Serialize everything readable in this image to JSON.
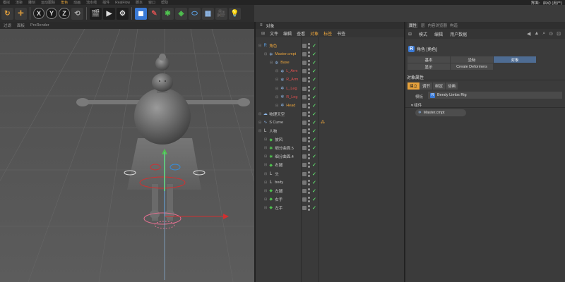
{
  "menubar": {
    "items": [
      "模拟",
      "渲染",
      "雕刻",
      "运动跟踪",
      "角色",
      "动画",
      "流水线",
      "插件",
      "RealFlow",
      "脚本",
      "窗口",
      "帮助"
    ],
    "layout_label": "界面:",
    "layout_value": "启动 (用户)"
  },
  "toolbar": {
    "axes": [
      "X",
      "Y",
      "Z"
    ]
  },
  "viewport": {
    "tabs": [
      "过滤",
      "面板",
      "ProRender"
    ]
  },
  "object_manager": {
    "title": "对象",
    "menu": [
      "文件",
      "编辑",
      "查看",
      "对象",
      "标签",
      "书签"
    ],
    "active_menu": "对象",
    "rows": [
      {
        "name": "角色",
        "indent": 0,
        "icon": "character-icon",
        "color": "#e8a33c",
        "tag": ""
      },
      {
        "name": "Master.cmpt",
        "indent": 1,
        "icon": "joint-icon",
        "color": "#e8a33c",
        "tag": ""
      },
      {
        "name": "Base",
        "indent": 2,
        "icon": "joint-icon",
        "color": "#e8a33c",
        "tag": ""
      },
      {
        "name": "L_Arm",
        "indent": 3,
        "icon": "joint-icon",
        "color": "#e05050",
        "tag": ""
      },
      {
        "name": "R_Arm",
        "indent": 3,
        "icon": "joint-icon",
        "color": "#e05050",
        "tag": ""
      },
      {
        "name": "L_Leg",
        "indent": 3,
        "icon": "joint-icon",
        "color": "#e05050",
        "tag": ""
      },
      {
        "name": "R_Leg",
        "indent": 3,
        "icon": "joint-icon",
        "color": "#e05050",
        "tag": ""
      },
      {
        "name": "Head",
        "indent": 3,
        "icon": "joint-icon",
        "color": "#e8a33c",
        "tag": ""
      },
      {
        "name": "物理天空",
        "indent": 0,
        "icon": "sky-icon",
        "color": "#c8c8c8",
        "tag": ""
      },
      {
        "name": "S Curve",
        "indent": 0,
        "icon": "spline-icon",
        "color": "#c8c8c8",
        "tag": "spline"
      },
      {
        "name": "人物",
        "indent": 0,
        "icon": "null-icon",
        "color": "#c8c8c8",
        "tag": ""
      },
      {
        "name": "披风",
        "indent": 1,
        "icon": "poly-icon",
        "color": "#c8c8c8",
        "tag": ""
      },
      {
        "name": "细分曲面.5",
        "indent": 1,
        "icon": "subdivision-icon",
        "color": "#c8c8c8",
        "tag": ""
      },
      {
        "name": "细分曲面.4",
        "indent": 1,
        "icon": "subdivision-icon",
        "color": "#c8c8c8",
        "tag": ""
      },
      {
        "name": "右腿",
        "indent": 1,
        "icon": "poly-icon",
        "color": "#c8c8c8",
        "tag": ""
      },
      {
        "name": "头",
        "indent": 1,
        "icon": "null-icon",
        "color": "#c8c8c8",
        "tag": ""
      },
      {
        "name": "body",
        "indent": 1,
        "icon": "null-icon",
        "color": "#c8c8c8",
        "tag": ""
      },
      {
        "name": "左腿",
        "indent": 1,
        "icon": "poly-icon",
        "color": "#c8c8c8",
        "tag": ""
      },
      {
        "name": "右手",
        "indent": 1,
        "icon": "poly-icon",
        "color": "#c8c8c8",
        "tag": ""
      },
      {
        "name": "左手",
        "indent": 1,
        "icon": "poly-icon",
        "color": "#c8c8c8",
        "tag": ""
      }
    ]
  },
  "attributes": {
    "tabs": [
      "属性",
      "层",
      "内容浏览器",
      "构造"
    ],
    "active_tab": "属性",
    "menu": [
      "模式",
      "编辑",
      "用户数据"
    ],
    "object_title": "角色 [角色]",
    "subtabs": [
      "基本",
      "坐标",
      "对象",
      "显示",
      "Create Deformers"
    ],
    "active_subtab": "对象",
    "section": "对象属性",
    "content_tabs": [
      "建立",
      "调节",
      "绑定",
      "动画"
    ],
    "active_content_tab": "建立",
    "template_label": "模板",
    "template_value": "Bendy Limbs Rig",
    "group_label": "▾ 组件",
    "component": "Master.cmpt"
  }
}
